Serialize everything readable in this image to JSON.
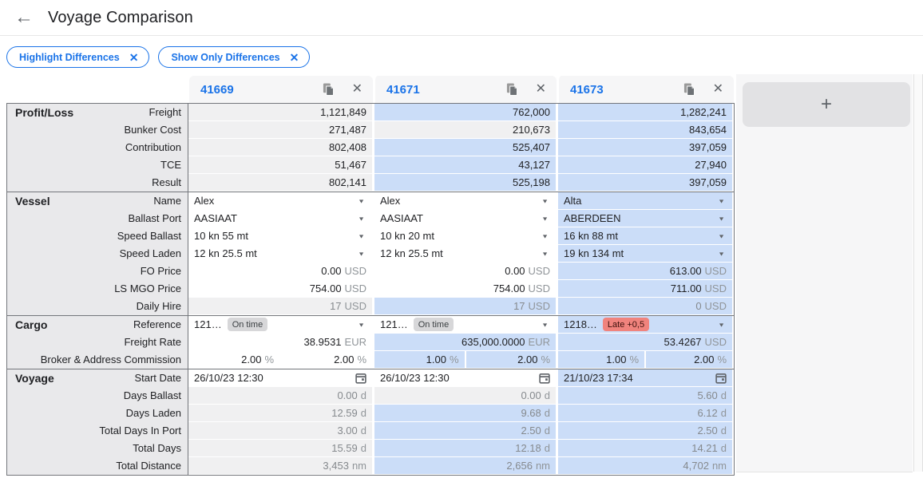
{
  "header": {
    "title": "Voyage Comparison"
  },
  "chips": [
    {
      "label": "Highlight Differences"
    },
    {
      "label": "Show Only Differences"
    }
  ],
  "columns": [
    "41669",
    "41671",
    "41673"
  ],
  "add_button": {
    "label": "+"
  },
  "icons": {
    "back": "←",
    "close": "✕",
    "caret": "▼",
    "copy": "copy-icon",
    "calendar": "calendar-icon"
  },
  "colors": {
    "accent": "#1a73e8",
    "highlight": "#cbddf8",
    "readonly_bg": "#f0f0f1",
    "label_bg": "#e9e9eb",
    "section_border": "#73767b",
    "badge_ontime_bg": "#d7d7d9",
    "badge_late_bg": "#f0837d",
    "unit_text": "#909599"
  },
  "sections": [
    {
      "name": "Profit/Loss",
      "rows": [
        {
          "label": "Freight",
          "cells": [
            {
              "type": "rodark",
              "value": "1,121,849"
            },
            {
              "type": "rodark",
              "value": "762,000",
              "hl": true
            },
            {
              "type": "rodark",
              "value": "1,282,241",
              "hl": true
            }
          ]
        },
        {
          "label": "Bunker Cost",
          "cells": [
            {
              "type": "rodark",
              "value": "271,487"
            },
            {
              "type": "rodark",
              "value": "210,673"
            },
            {
              "type": "rodark",
              "value": "843,654",
              "hl": true
            }
          ]
        },
        {
          "label": "Contribution",
          "cells": [
            {
              "type": "rodark",
              "value": "802,408"
            },
            {
              "type": "rodark",
              "value": "525,407",
              "hl": true
            },
            {
              "type": "rodark",
              "value": "397,059",
              "hl": true
            }
          ]
        },
        {
          "label": "TCE",
          "cells": [
            {
              "type": "rodark",
              "value": "51,467"
            },
            {
              "type": "rodark",
              "value": "43,127",
              "hl": true
            },
            {
              "type": "rodark",
              "value": "27,940",
              "hl": true
            }
          ]
        },
        {
          "label": "Result",
          "cells": [
            {
              "type": "rodark",
              "value": "802,141"
            },
            {
              "type": "rodark",
              "value": "525,198",
              "hl": true
            },
            {
              "type": "rodark",
              "value": "397,059",
              "hl": true
            }
          ]
        }
      ]
    },
    {
      "name": "Vessel",
      "rows": [
        {
          "label": "Name",
          "cells": [
            {
              "type": "select",
              "value": "Alex"
            },
            {
              "type": "select",
              "value": "Alex"
            },
            {
              "type": "select",
              "value": "Alta",
              "hl": true
            }
          ]
        },
        {
          "label": "Ballast Port",
          "cells": [
            {
              "type": "select",
              "value": "AASIAAT"
            },
            {
              "type": "select",
              "value": "AASIAAT"
            },
            {
              "type": "select",
              "value": "ABERDEEN",
              "hl": true
            }
          ]
        },
        {
          "label": "Speed Ballast",
          "cells": [
            {
              "type": "select",
              "value": "10 kn 55 mt"
            },
            {
              "type": "select",
              "value": "10 kn 20 mt"
            },
            {
              "type": "select",
              "value": "16 kn 88 mt",
              "hl": true
            }
          ]
        },
        {
          "label": "Speed Laden",
          "cells": [
            {
              "type": "select",
              "value": "12 kn 25.5 mt"
            },
            {
              "type": "select",
              "value": "12 kn 25.5 mt"
            },
            {
              "type": "select",
              "value": "19 kn 134 mt",
              "hl": true
            }
          ]
        },
        {
          "label": "FO Price",
          "cells": [
            {
              "type": "num",
              "value": "0.00",
              "unit": "USD"
            },
            {
              "type": "num",
              "value": "0.00",
              "unit": "USD"
            },
            {
              "type": "num",
              "value": "613.00",
              "unit": "USD",
              "hl": true
            }
          ]
        },
        {
          "label": "LS MGO Price",
          "cells": [
            {
              "type": "num",
              "value": "754.00",
              "unit": "USD"
            },
            {
              "type": "num",
              "value": "754.00",
              "unit": "USD"
            },
            {
              "type": "num",
              "value": "711.00",
              "unit": "USD",
              "hl": true
            }
          ]
        },
        {
          "label": "Daily Hire",
          "cells": [
            {
              "type": "ro",
              "value": "17",
              "unit": "USD"
            },
            {
              "type": "ro",
              "value": "17",
              "unit": "USD",
              "hl": true
            },
            {
              "type": "ro",
              "value": "0",
              "unit": "USD",
              "hl": true
            }
          ]
        }
      ]
    },
    {
      "name": "Cargo",
      "rows": [
        {
          "label": "Reference",
          "cells": [
            {
              "type": "select",
              "value": "121…",
              "badge": "On time",
              "badge_type": "ontime"
            },
            {
              "type": "select",
              "value": "121…",
              "badge": "On time",
              "badge_type": "ontime"
            },
            {
              "type": "select",
              "value": "1218…",
              "badge": "Late +0,5",
              "badge_type": "late",
              "hl": true
            }
          ]
        },
        {
          "label": "Freight Rate",
          "cells": [
            {
              "type": "num",
              "value": "38.9531",
              "unit": "EUR"
            },
            {
              "type": "num",
              "value": "635,000.0000",
              "unit": "EUR",
              "hl": true
            },
            {
              "type": "num",
              "value": "53.4267",
              "unit": "USD",
              "hl": true
            }
          ]
        },
        {
          "label": "Broker & Address Commission",
          "cells": [
            {
              "type": "split",
              "v1": "2.00",
              "v2": "2.00",
              "unit": "%"
            },
            {
              "type": "split",
              "v1": "1.00",
              "v2": "2.00",
              "unit": "%",
              "hl": true
            },
            {
              "type": "split",
              "v1": "1.00",
              "v2": "2.00",
              "unit": "%",
              "hl": true
            }
          ]
        }
      ]
    },
    {
      "name": "Voyage",
      "rows": [
        {
          "label": "Start Date",
          "cells": [
            {
              "type": "date",
              "value": "26/10/23 12:30"
            },
            {
              "type": "date",
              "value": "26/10/23 12:30"
            },
            {
              "type": "date",
              "value": "21/10/23 17:34",
              "hl": true
            }
          ]
        },
        {
          "label": "Days Ballast",
          "cells": [
            {
              "type": "ro",
              "value": "0.00",
              "unit": "d"
            },
            {
              "type": "ro",
              "value": "0.00",
              "unit": "d"
            },
            {
              "type": "ro",
              "value": "5.60",
              "unit": "d",
              "hl": true
            }
          ]
        },
        {
          "label": "Days Laden",
          "cells": [
            {
              "type": "ro",
              "value": "12.59",
              "unit": "d"
            },
            {
              "type": "ro",
              "value": "9.68",
              "unit": "d",
              "hl": true
            },
            {
              "type": "ro",
              "value": "6.12",
              "unit": "d",
              "hl": true
            }
          ]
        },
        {
          "label": "Total Days In Port",
          "cells": [
            {
              "type": "ro",
              "value": "3.00",
              "unit": "d"
            },
            {
              "type": "ro",
              "value": "2.50",
              "unit": "d",
              "hl": true
            },
            {
              "type": "ro",
              "value": "2.50",
              "unit": "d",
              "hl": true
            }
          ]
        },
        {
          "label": "Total Days",
          "cells": [
            {
              "type": "ro",
              "value": "15.59",
              "unit": "d"
            },
            {
              "type": "ro",
              "value": "12.18",
              "unit": "d",
              "hl": true
            },
            {
              "type": "ro",
              "value": "14.21",
              "unit": "d",
              "hl": true
            }
          ]
        },
        {
          "label": "Total Distance",
          "cells": [
            {
              "type": "ro",
              "value": "3,453",
              "unit": "nm"
            },
            {
              "type": "ro",
              "value": "2,656",
              "unit": "nm",
              "hl": true
            },
            {
              "type": "ro",
              "value": "4,702",
              "unit": "nm",
              "hl": true
            }
          ]
        }
      ]
    }
  ]
}
